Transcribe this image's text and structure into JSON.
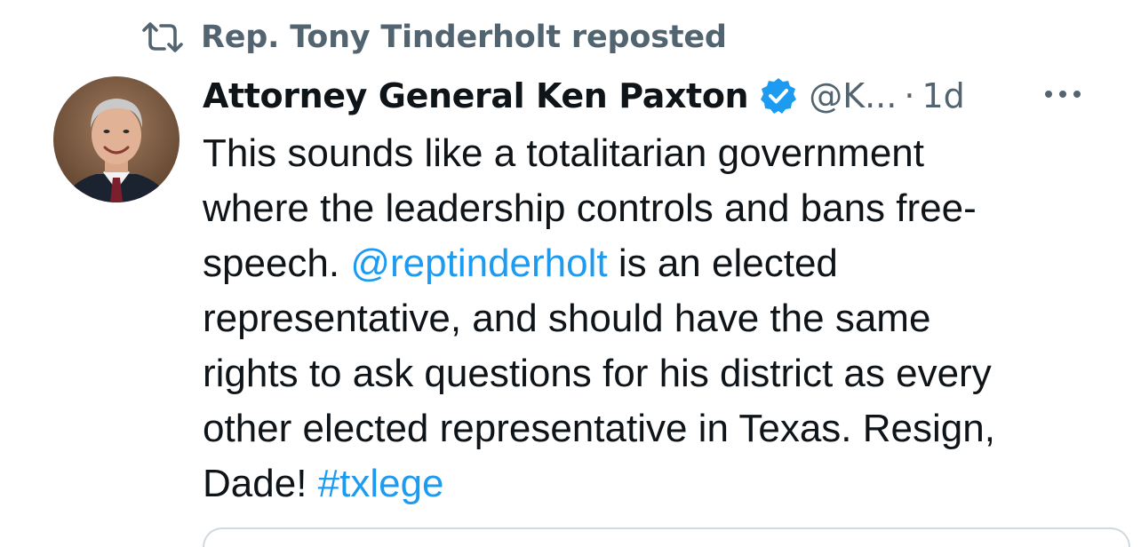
{
  "repost": {
    "icon": "repost-icon",
    "text": "Rep. Tony Tinderholt reposted"
  },
  "author": {
    "avatar": "avatar",
    "name": "Attorney General Ken Paxton",
    "verified_icon": "verified-badge-icon",
    "handle": "@K...",
    "separator": "·",
    "time": "1d"
  },
  "more_icon": "more-icon",
  "tweet": {
    "line1": "This sounds like a totalitarian government",
    "line2": "where the leadership controls and bans free-",
    "line3_pre": "speech. ",
    "mention": "@reptinderholt",
    "line3_post": " is an elected",
    "line4": "representative, and should have the same",
    "line5": "rights to ask questions for his district as every",
    "line6": "other elected representative in Texas. Resign,",
    "line7_pre": "Dade! ",
    "hashtag": "#txlege"
  },
  "colors": {
    "text": "#0f1419",
    "muted": "#536471",
    "link": "#1d9bf0",
    "border": "#cfd9de"
  }
}
